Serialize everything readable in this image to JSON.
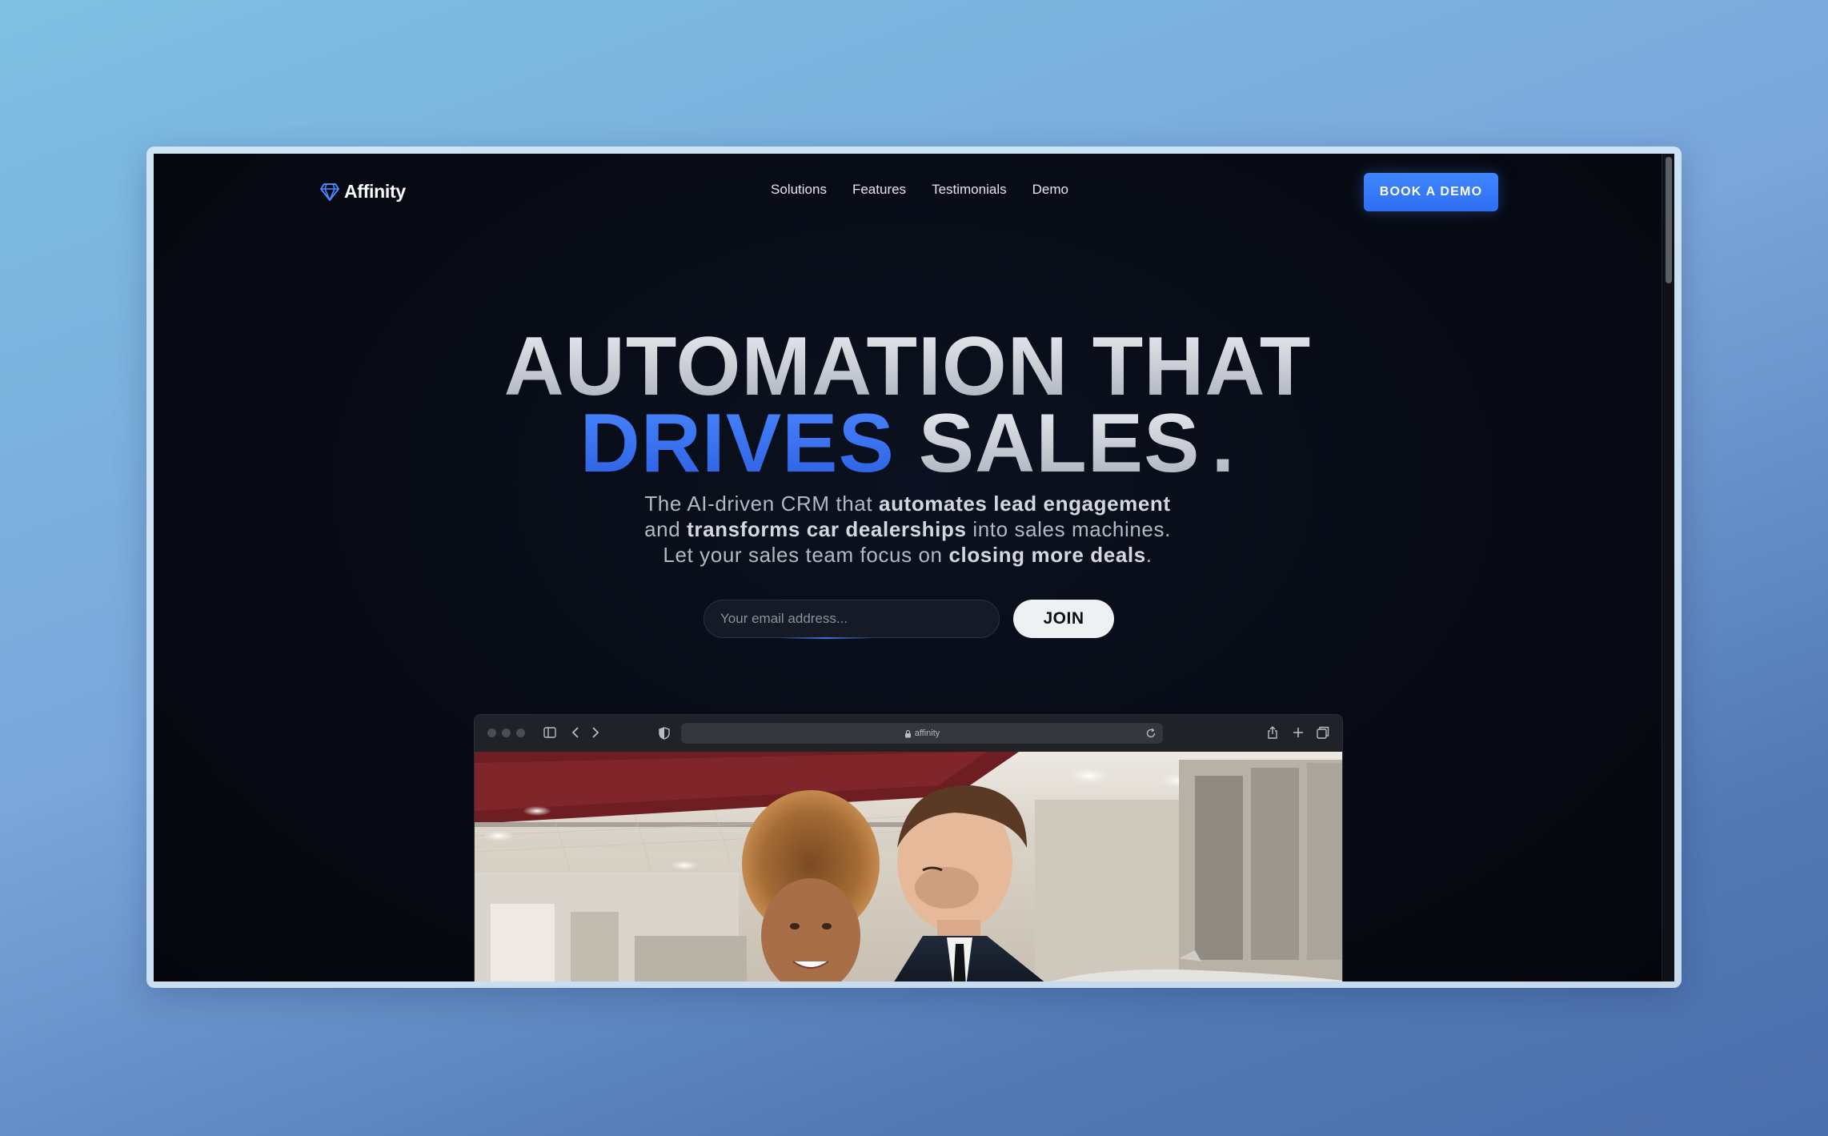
{
  "nav": {
    "brand": "Affinity",
    "links": [
      "Solutions",
      "Features",
      "Testimonials",
      "Demo"
    ],
    "cta": "BOOK A DEMO"
  },
  "hero": {
    "line1": "AUTOMATION THAT",
    "line2_accent": "DRIVES",
    "line2_rest": "SALES",
    "line2_period": ".",
    "sub": {
      "l1_a": "The AI-driven CRM that ",
      "l1_b": "automates lead engagement",
      "l2_a": "and ",
      "l2_b": "transforms car dealerships",
      "l2_c": " into sales machines.",
      "l3_a": "Let your sales team focus on ",
      "l3_b": "closing more deals",
      "l3_c": "."
    }
  },
  "form": {
    "email_placeholder": "Your email address...",
    "join": "JOIN"
  },
  "browser": {
    "url": "affinity"
  },
  "colors": {
    "accent": "#3b82f6",
    "background": "#070a13"
  }
}
